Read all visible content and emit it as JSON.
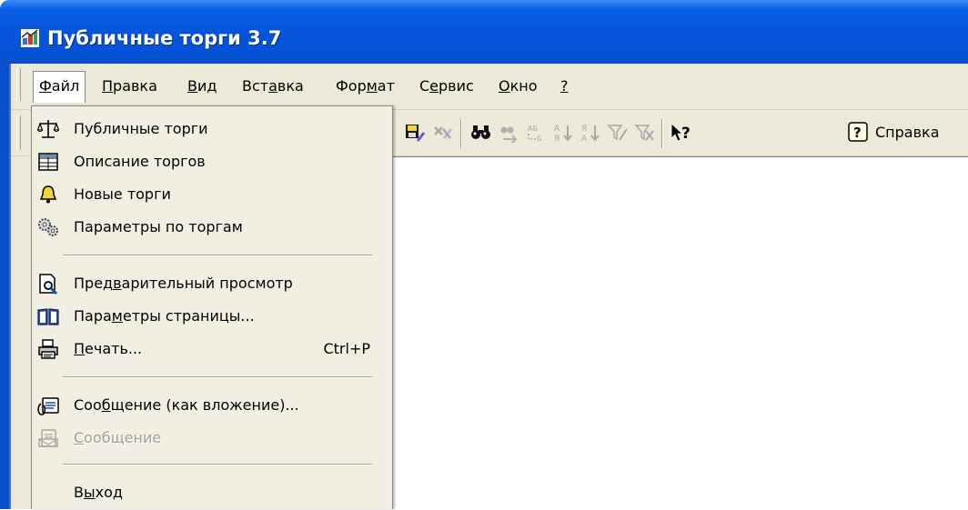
{
  "window": {
    "title": "Публичные торги 3.7",
    "icon": "app-icon"
  },
  "menubar": {
    "items": [
      {
        "label": "Файл",
        "underline": "Ф",
        "active": true
      },
      {
        "label": "Правка",
        "underline": "П"
      },
      {
        "label": "Вид",
        "underline": "В"
      },
      {
        "label": "Вставка",
        "underline": "а"
      },
      {
        "label": "Формат",
        "underline": "м"
      },
      {
        "label": "Сервис",
        "underline": "е"
      },
      {
        "label": "Окно",
        "underline": "О"
      },
      {
        "label": "?",
        "underline": "?"
      }
    ]
  },
  "toolbar": {
    "buttons": [
      {
        "icon": "save-close-icon",
        "enabled": true
      },
      {
        "icon": "delete-record-icon",
        "enabled": false
      },
      {
        "icon": "find-icon",
        "enabled": true
      },
      {
        "icon": "find-next-icon",
        "enabled": false
      },
      {
        "icon": "replace-icon",
        "enabled": false
      },
      {
        "icon": "sort-ascending-icon",
        "enabled": false
      },
      {
        "icon": "sort-descending-icon",
        "enabled": false
      },
      {
        "icon": "filter-icon",
        "enabled": false
      },
      {
        "icon": "remove-filter-icon",
        "enabled": false
      },
      {
        "icon": "whats-this-icon",
        "enabled": true
      }
    ],
    "help_label": "Справка"
  },
  "file_menu": {
    "items": [
      {
        "label": "Публичные торги",
        "icon": "scales-icon",
        "enabled": true
      },
      {
        "label": "Описание торгов",
        "icon": "table-icon",
        "enabled": true
      },
      {
        "label": "Новые торги",
        "icon": "bell-icon",
        "enabled": true
      },
      {
        "label": "Параметры по торгам",
        "icon": "gears-icon",
        "enabled": true
      },
      {
        "separator": true
      },
      {
        "label": "Предварительный просмотр",
        "underline": "в",
        "icon": "print-preview-icon",
        "enabled": true
      },
      {
        "label": "Параметры страницы...",
        "underline": "м",
        "icon": "page-setup-icon",
        "enabled": true
      },
      {
        "label": "Печать...",
        "underline": "П",
        "shortcut": "Ctrl+P",
        "icon": "printer-icon",
        "enabled": true
      },
      {
        "separator": true
      },
      {
        "label": "Сообщение (как вложение)...",
        "underline": "б",
        "icon": "mail-attachment-icon",
        "enabled": true
      },
      {
        "label": "Сообщение",
        "underline": "С",
        "icon": "mail-icon",
        "enabled": false
      },
      {
        "separator": true
      },
      {
        "label": "Выход",
        "underline": "ы",
        "enabled": true
      }
    ]
  },
  "colors": {
    "title_bar": "#0455dc",
    "menu_background": "#ece9d8",
    "dropdown_background": "#f1efe2",
    "disabled_text": "#a0a098"
  }
}
